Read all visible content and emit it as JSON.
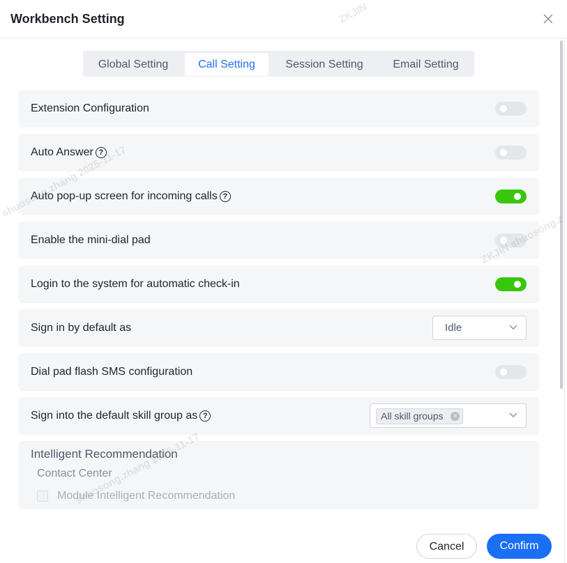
{
  "dialog": {
    "title": "Workbench Setting",
    "close_icon": "close-icon"
  },
  "tabs": [
    {
      "label": "Global Setting",
      "active": false
    },
    {
      "label": "Call Setting",
      "active": true
    },
    {
      "label": "Session Setting",
      "active": false
    },
    {
      "label": "Email Setting",
      "active": false
    }
  ],
  "settings": {
    "extension_configuration": {
      "label": "Extension Configuration",
      "enabled": false
    },
    "auto_answer": {
      "label": "Auto Answer",
      "enabled": false
    },
    "auto_popup": {
      "label": "Auto pop-up screen for incoming calls",
      "enabled": true
    },
    "mini_dial_pad": {
      "label": "Enable the mini-dial pad",
      "enabled": false
    },
    "auto_checkin": {
      "label": "Login to the system for automatic check-in",
      "enabled": true
    },
    "sign_in_default": {
      "label": "Sign in by default as",
      "value": "Idle"
    },
    "dial_pad_flash_sms": {
      "label": "Dial pad flash SMS configuration",
      "enabled": false
    },
    "default_skill_group": {
      "label": "Sign into the default skill group as",
      "tag": "All skill groups"
    }
  },
  "intelligent_recommendation": {
    "title": "Intelligent Recommendation",
    "subtitle": "Contact Center",
    "checkbox_label": "Module Intelligent Recommendation",
    "checked": false
  },
  "footer": {
    "cancel_label": "Cancel",
    "confirm_label": "Confirm"
  },
  "watermark": {
    "text_1": "ZKJIN",
    "text_2": "shuosong.zhang 2025-11-17",
    "text_3": "ZKJIN shuosong.z"
  },
  "colors": {
    "accent": "#1b6ff5",
    "switch_on": "#38c70c",
    "switch_off": "#e5e6eb",
    "row_bg": "#f5f6f8"
  }
}
